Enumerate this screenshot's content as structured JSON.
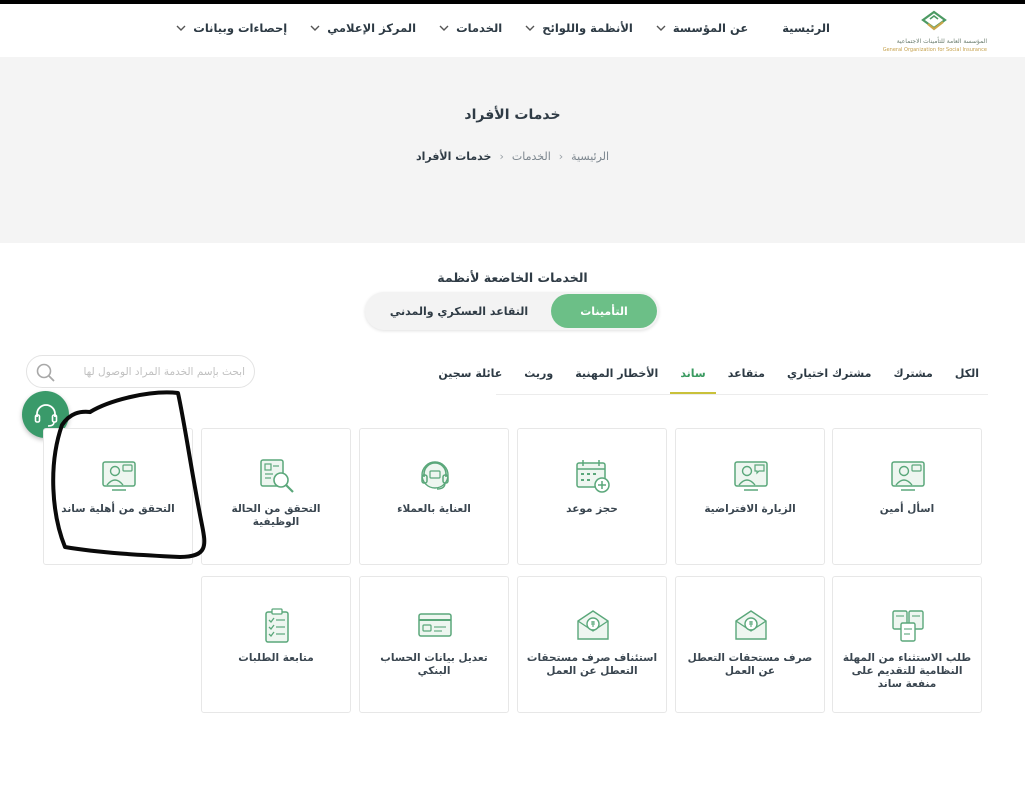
{
  "header": {
    "logo_text_ar": "المؤسسة العامة للتأمينات الاجتماعية",
    "logo_text_en": "General Organization for Social Insurance",
    "nav": [
      {
        "label": "الرئيسية",
        "has_dropdown": false
      },
      {
        "label": "عن المؤسسة",
        "has_dropdown": true
      },
      {
        "label": "الأنظمة واللوائح",
        "has_dropdown": true
      },
      {
        "label": "الخدمات",
        "has_dropdown": true
      },
      {
        "label": "المركز الإعلامي",
        "has_dropdown": true
      },
      {
        "label": "إحصاءات وبيانات",
        "has_dropdown": true
      }
    ]
  },
  "hero": {
    "title": "خدمات الأفراد",
    "breadcrumb": [
      "الرئيسية",
      "الخدمات",
      "خدمات الأفراد"
    ]
  },
  "section": {
    "title": "الخدمات الخاضعة لأنظمة",
    "segments": [
      {
        "label": "التأمينات",
        "active": true
      },
      {
        "label": "التقاعد العسكري والمدني",
        "active": false
      }
    ]
  },
  "filters": {
    "items": [
      "الكل",
      "مشترك",
      "مشترك اختياري",
      "متقاعد",
      "ساند",
      "الأخطار المهنية",
      "وريث",
      "عائلة سجين"
    ],
    "active": "ساند"
  },
  "search": {
    "placeholder": "ابحث بإسم الخدمة المراد الوصول لها"
  },
  "cards_row1": [
    {
      "label": "اسأل أمين",
      "icon": "video-consult-icon"
    },
    {
      "label": "الزيارة الافتراضية",
      "icon": "virtual-visit-icon"
    },
    {
      "label": "حجز موعد",
      "icon": "calendar-add-icon"
    },
    {
      "label": "العناية بالعملاء",
      "icon": "headset-support-icon"
    },
    {
      "label": "التحقق من الحالة الوظيفية",
      "icon": "document-search-icon"
    },
    {
      "label": "التحقق من أهلية ساند",
      "icon": "video-consult-icon"
    }
  ],
  "cards_row2": [
    {
      "label": "طلب الاستثناء من المهلة النظامية للتقديم على منفعة ساند",
      "icon": "documents-icon"
    },
    {
      "label": "صرف مستحقات التعطل عن العمل",
      "icon": "money-envelope-icon"
    },
    {
      "label": "استئناف صرف مستحقات التعطل عن العمل",
      "icon": "money-envelope-icon"
    },
    {
      "label": "تعديل بيانات الحساب البنكي",
      "icon": "bank-card-icon"
    },
    {
      "label": "متابعة الطلبات",
      "icon": "checklist-icon"
    }
  ],
  "colors": {
    "brand_green": "#6cbf87",
    "support_green": "#3a9a6a",
    "active_filter": "#3a9a60",
    "underline": "#c9c13a",
    "icon_green": "#5aa77a"
  }
}
